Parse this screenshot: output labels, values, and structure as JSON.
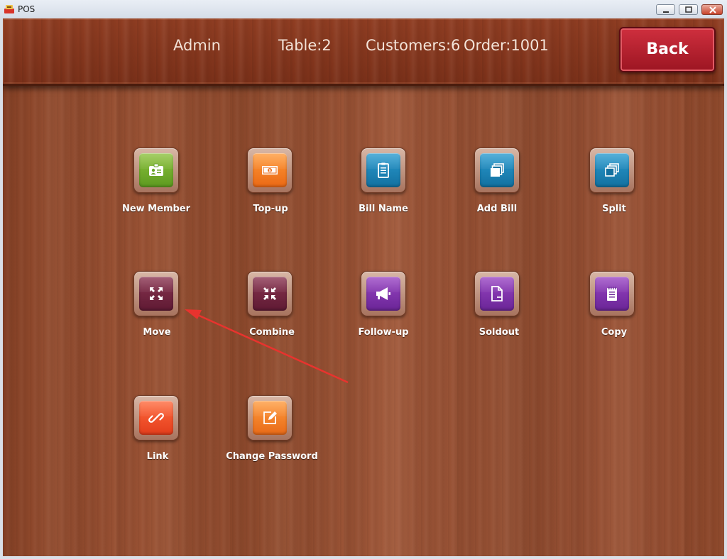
{
  "window": {
    "title": "POS"
  },
  "header": {
    "admin": "Admin",
    "table": "Table:2",
    "customers": "Customers:6",
    "order": "Order:1001",
    "back_label": "Back"
  },
  "colors": {
    "back_button": "#b51e2c",
    "annotation_arrow": "#e8332e"
  },
  "functions": [
    {
      "label": "New Member",
      "icon": "id-card-icon"
    },
    {
      "label": "Top-up",
      "icon": "cash-icon"
    },
    {
      "label": "Bill Name",
      "icon": "clipboard-icon"
    },
    {
      "label": "Add Bill",
      "icon": "stacked-pages-icon"
    },
    {
      "label": "Split",
      "icon": "copy-pages-icon"
    },
    {
      "label": "Move",
      "icon": "expand-arrows-icon"
    },
    {
      "label": "Combine",
      "icon": "collapse-arrows-icon"
    },
    {
      "label": "Follow-up",
      "icon": "megaphone-icon"
    },
    {
      "label": "Soldout",
      "icon": "document-minus-icon"
    },
    {
      "label": "Copy",
      "icon": "notepad-icon"
    },
    {
      "label": "Link",
      "icon": "chain-link-icon"
    },
    {
      "label": "Change Password",
      "icon": "edit-icon"
    }
  ]
}
